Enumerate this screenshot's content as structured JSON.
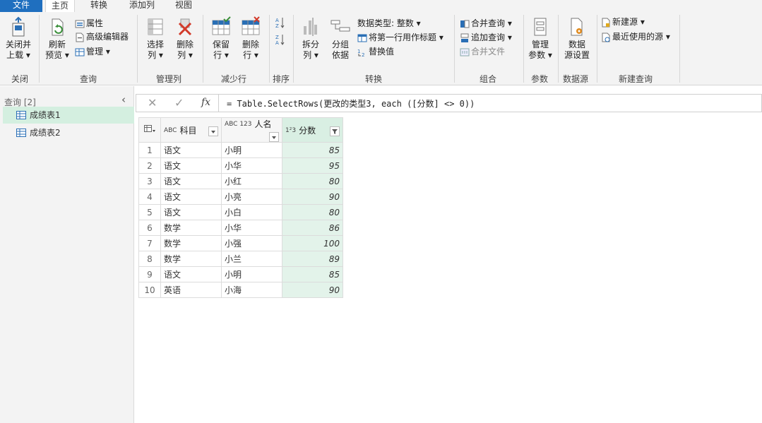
{
  "tabs": [
    "文件",
    "主页",
    "转换",
    "添加列",
    "视图"
  ],
  "ribbon": {
    "close_load": [
      "关闭并",
      "上载 ▾"
    ],
    "refresh": [
      "刷新",
      "预览 ▾"
    ],
    "properties": "属性",
    "advanced_editor": "高级编辑器",
    "manage": "管理 ▾",
    "choose_cols": [
      "选择",
      "列 ▾"
    ],
    "remove_cols": [
      "删除",
      "列 ▾"
    ],
    "keep_rows": [
      "保留",
      "行 ▾"
    ],
    "remove_rows": [
      "删除",
      "行 ▾"
    ],
    "split": [
      "拆分",
      "列 ▾"
    ],
    "group": [
      "分组",
      "依据"
    ],
    "data_type": "数据类型: 整数 ▾",
    "first_row_header": "将第一行用作标题 ▾",
    "replace_values": "替换值",
    "merge_queries": "合并查询 ▾",
    "append_queries": "追加查询 ▾",
    "combine_files": "合并文件",
    "manage_params": [
      "管理",
      "参数 ▾"
    ],
    "ds_settings": [
      "数据",
      "源设置"
    ],
    "new_source": "新建源 ▾",
    "recent_sources": "最近使用的源 ▾",
    "groups": [
      "关闭",
      "查询",
      "管理列",
      "减少行",
      "排序",
      "转换",
      "组合",
      "参数",
      "数据源",
      "新建查询"
    ]
  },
  "queries": {
    "header": "查询 [2]",
    "items": [
      "成绩表1",
      "成绩表2"
    ]
  },
  "formula": "= Table.SelectRows(更改的类型3, each ([分数] <> 0))",
  "grid": {
    "headers": [
      "科目",
      "人名",
      "分数"
    ],
    "type_badges": [
      "ABC",
      "ABC 123",
      "1²3"
    ],
    "rows": [
      [
        "1",
        "语文",
        "小明",
        "85"
      ],
      [
        "2",
        "语文",
        "小华",
        "95"
      ],
      [
        "3",
        "语文",
        "小红",
        "80"
      ],
      [
        "4",
        "语文",
        "小亮",
        "90"
      ],
      [
        "5",
        "语文",
        "小白",
        "80"
      ],
      [
        "6",
        "数学",
        "小华",
        "86"
      ],
      [
        "7",
        "数学",
        "小强",
        "100"
      ],
      [
        "8",
        "数学",
        "小兰",
        "89"
      ],
      [
        "9",
        "语文",
        "小明",
        "85"
      ],
      [
        "10",
        "英语",
        "小海",
        "90"
      ]
    ]
  },
  "colors": {
    "file_tab": "#1f6fbf",
    "selected_query": "#d4efe0",
    "filtered_col": "#e3f3ea"
  }
}
